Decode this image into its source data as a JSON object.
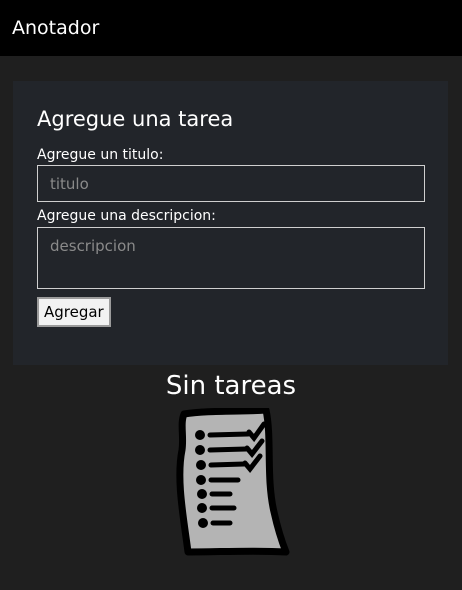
{
  "app": {
    "title": "Anotador"
  },
  "form": {
    "heading": "Agregue una tarea",
    "title_label": "Agregue un titulo:",
    "title_placeholder": "titulo",
    "description_label": "Agregue una descripcion:",
    "description_placeholder": "descripcion",
    "submit_label": "Agregar"
  },
  "tasks": {
    "empty_message": "Sin tareas",
    "empty_icon": "checklist-paper-icon"
  },
  "colors": {
    "topbar": "#000000",
    "background": "#1f1f1f",
    "card": "#22252a",
    "text": "#ffffff"
  }
}
